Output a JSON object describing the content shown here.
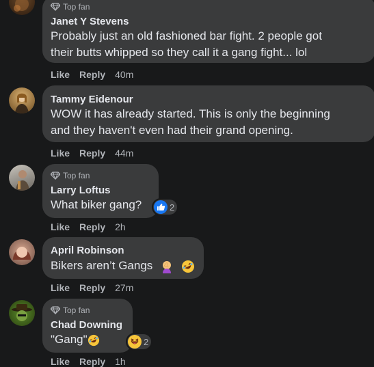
{
  "comments": [
    {
      "top_fan_label": "Top fan",
      "name": "Janet Y Stevens",
      "lines": [
        "Probably just an old fashioned bar fight. 2 people got",
        "their butts whipped so they call it a gang fight... lol"
      ],
      "like": "Like",
      "reply": "Reply",
      "time": "40m"
    },
    {
      "name": "Tammy Eidenour",
      "lines": [
        "WOW it has already started. This is only the beginning",
        "and they haven't even had their grand opening."
      ],
      "like": "Like",
      "reply": "Reply",
      "time": "44m"
    },
    {
      "top_fan_label": "Top fan",
      "name": "Larry Loftus",
      "lines": [
        "What biker gang?"
      ],
      "reaction_count": "2",
      "reaction_icon": "like-thumb-icon",
      "like": "Like",
      "reply": "Reply",
      "time": "2h"
    },
    {
      "name": "April Robinson",
      "lines": [
        "Bikers aren’t Gangs"
      ],
      "inline_emojis": [
        "woman-facepalming-icon",
        "rofl-emoji-icon"
      ],
      "like": "Like",
      "reply": "Reply",
      "time": "27m"
    },
    {
      "top_fan_label": "Top fan",
      "name": "Chad Downing",
      "lines": [
        "\"Gang\""
      ],
      "inline_emojis": [
        "rofl-emoji-icon"
      ],
      "reaction_count": "2",
      "reaction_icon": "haha-reaction-icon",
      "like": "Like",
      "reply": "Reply",
      "time": "1h"
    }
  ],
  "colors": {
    "background": "#18191a",
    "bubble": "#3a3b3c",
    "primary_text": "#e4e6eb",
    "secondary_text": "#b0b3b8",
    "like_blue": "#1877f2"
  }
}
